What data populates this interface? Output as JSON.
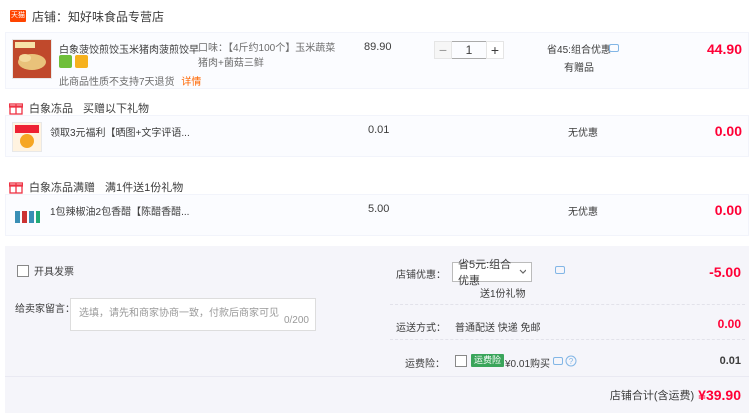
{
  "shop": {
    "label": "店铺：知好味食品专营店",
    "logo_text": "天猫"
  },
  "item1": {
    "title": "白象菠饺煎饺玉米猪肉菠煎饺早...",
    "sku": "口味：【4斤约100个】玉米蔬菜猪肉+菌菇三鲜",
    "price": "89.90",
    "qty": "1",
    "promo": "省45:组合优惠",
    "promo_sub": "有赠品",
    "amount": "44.90",
    "note": "此商品性质不支持7天退货",
    "note_link": "详情"
  },
  "gift1_title": {
    "brand": "白象冻品",
    "desc": "买赠以下礼物"
  },
  "gift1": {
    "name": "领取3元福利【晒图+文字评语...",
    "price": "0.01",
    "promo": "无优惠",
    "amount": "0.00"
  },
  "gift2_title": {
    "brand": "白象冻品满赠",
    "desc": "满1件送1份礼物"
  },
  "gift2": {
    "name": "1包辣椒油2包香醋【陈醋香醋...",
    "price": "5.00",
    "promo": "无优惠",
    "amount": "0.00"
  },
  "invoice": {
    "label": "开具发票"
  },
  "message": {
    "label": "给卖家留言：",
    "placeholder": "选填，请先和商家协商一致，付款后商家可见",
    "count": "0/200"
  },
  "shop_discount": {
    "label": "店铺优惠：",
    "selected": "省5元:组合优惠",
    "gift": "送1份礼物",
    "amount": "-5.00"
  },
  "shipping": {
    "label": "运送方式：",
    "value": "普通配送 快递 免邮",
    "amount": "0.00"
  },
  "insurance": {
    "label": "运费险：",
    "tag": "运费险",
    "price": "¥0.01购买",
    "amount": "0.01"
  },
  "total": {
    "label": "店铺合计(含运费)",
    "amount": "¥39.90"
  },
  "colors": {
    "accent": "#ff0036",
    "brand": "#ff4400"
  }
}
